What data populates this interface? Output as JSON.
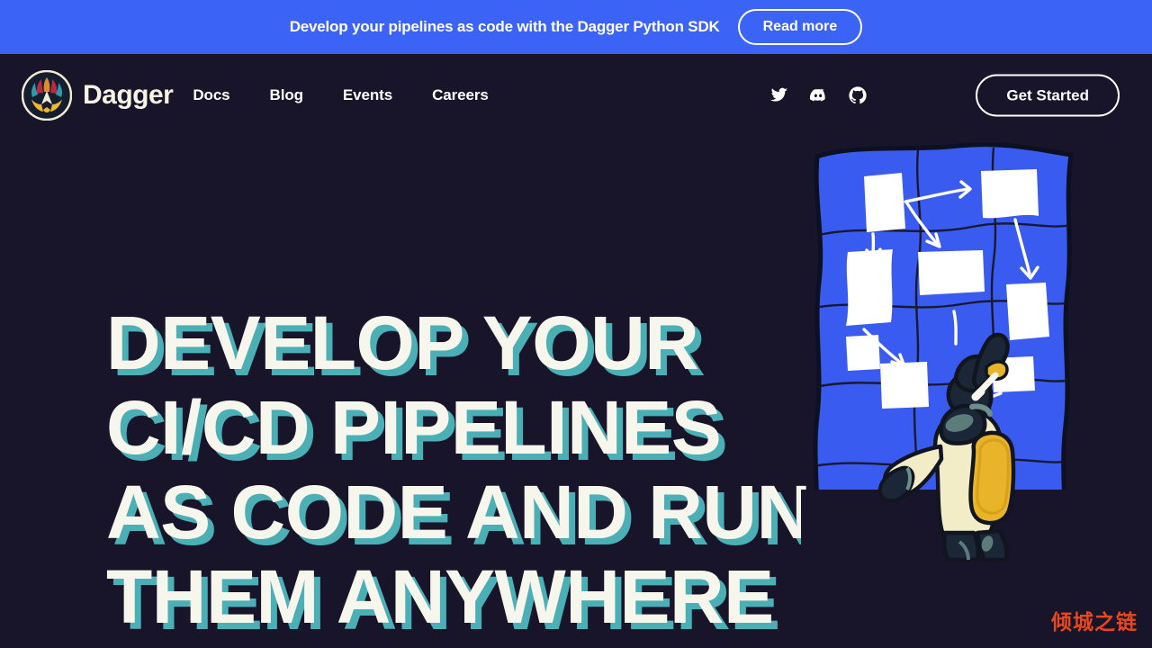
{
  "banner": {
    "text": "Develop your pipelines as code with the Dagger Python SDK",
    "button_label": "Read more"
  },
  "header": {
    "brand_name": "Dagger",
    "logo_icon": "dagger-mask-logo",
    "nav": [
      {
        "label": "Docs"
      },
      {
        "label": "Blog"
      },
      {
        "label": "Events"
      },
      {
        "label": "Careers"
      }
    ],
    "social": [
      {
        "icon": "twitter-icon",
        "name": "Twitter"
      },
      {
        "icon": "discord-icon",
        "name": "Discord"
      },
      {
        "icon": "github-icon",
        "name": "GitHub"
      }
    ],
    "cta_label": "Get Started"
  },
  "hero": {
    "headline_lines": [
      "Develop your",
      "CI/CD pipelines",
      "as code and run",
      "them anywhere"
    ],
    "illustration_name": "person-drawing-pipeline-flowchart-on-blue-board"
  },
  "watermark": {
    "text": "倾城之链"
  },
  "colors": {
    "page_background": "#181429",
    "banner_blue": "#3B63F6",
    "headline_cream": "#F7F6EC",
    "headline_shadow_teal": "#4BAFB6",
    "board_blue": "#3A5BF0",
    "accent_yellow": "#E8B52A",
    "outfit_cream": "#F2EDC6",
    "dark_navy": "#1B2736",
    "watermark_orange": "#E8481C",
    "logo_ring_cream": "#F3EBD4",
    "logo_crimson": "#B62A45",
    "logo_teal": "#2E9CA8"
  }
}
